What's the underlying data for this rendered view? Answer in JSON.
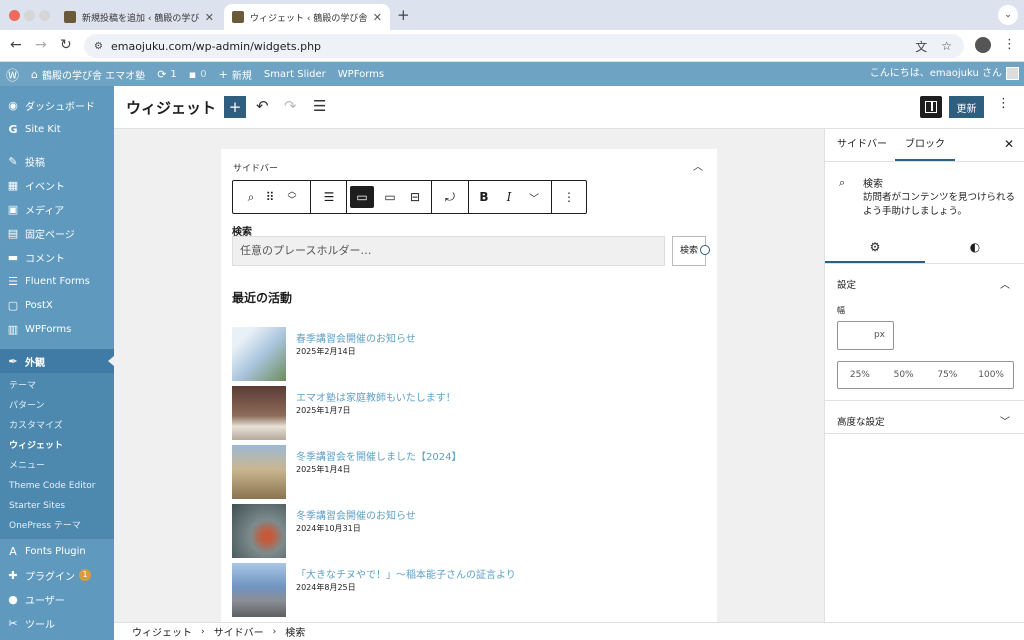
{
  "browser": {
    "tabs": [
      {
        "title": "新規投稿を追加 ‹ 鶴殿の学び舎 エマオ塾 — WordPress",
        "active": false
      },
      {
        "title": "ウィジェット ‹ 鶴殿の学び舎 エマオ塾 — WordPress",
        "active": true
      }
    ],
    "url": "emaojuku.com/wp-admin/widgets.php",
    "icons": [
      "back-icon",
      "forward-icon",
      "reload-icon",
      "site-settings-icon",
      "translate-icon",
      "bookmark-star-icon",
      "profile-avatar",
      "more-vert-icon"
    ]
  },
  "adminbar": {
    "site_name": "鶴殿の学び舎 エマオ塾",
    "updates": "1",
    "comments": "0",
    "new": "新規",
    "smart_slider": "Smart Slider",
    "wpforms": "WPForms",
    "howdy": "こんにちは、emaojuku さん"
  },
  "sidebar": {
    "items_top": [
      {
        "icon": "dashboard-icon",
        "label": "ダッシュボード"
      },
      {
        "icon": "site-kit-icon",
        "label": "Site Kit"
      },
      {
        "icon": "pin-icon",
        "label": "投稿"
      },
      {
        "icon": "calendar-icon",
        "label": "イベント"
      },
      {
        "icon": "media-icon",
        "label": "メディア"
      },
      {
        "icon": "page-icon",
        "label": "固定ページ"
      },
      {
        "icon": "comment-icon",
        "label": "コメント"
      },
      {
        "icon": "forms-icon",
        "label": "Fluent Forms"
      },
      {
        "icon": "postx-icon",
        "label": "PostX"
      },
      {
        "icon": "wpforms-icon",
        "label": "WPForms"
      }
    ],
    "current": {
      "icon": "appearance-icon",
      "label": "外観"
    },
    "submenu": [
      "テーマ",
      "パターン",
      "カスタマイズ",
      "ウィジェット",
      "メニュー",
      "Theme Code Editor",
      "Starter Sites",
      "OnePress テーマ"
    ],
    "active_submenu": "ウィジェット",
    "items_bottom": [
      {
        "icon": "fonts-icon",
        "label": "Fonts Plugin"
      },
      {
        "icon": "plugin-icon",
        "label": "プラグイン",
        "badge": "1"
      },
      {
        "icon": "user-icon",
        "label": "ユーザー"
      },
      {
        "icon": "tools-icon",
        "label": "ツール"
      }
    ]
  },
  "editor": {
    "title": "ウィジェット",
    "update_label": "更新"
  },
  "widget_area": {
    "title": "サイドバー",
    "search_label": "検索",
    "search_placeholder": "任意のプレースホルダー…",
    "search_button": "検索",
    "recent_title": "最近の活動",
    "posts": [
      {
        "title": "春季講習会開催のお知らせ",
        "date": "2025年2月14日",
        "thumb": "#bcd3e6"
      },
      {
        "title": "エマオ塾は家庭教師もいたします！",
        "date": "2025年1月7日",
        "thumb": "#7a5a4a"
      },
      {
        "title": "冬季講習会を開催しました【2024】",
        "date": "2025年1月4日",
        "thumb": "#9a8a6a"
      },
      {
        "title": "冬季講習会開催のお知らせ",
        "date": "2024年10月31日",
        "thumb": "#6a7a82"
      },
      {
        "title": "「大きなチヌやで！」〜稲本能子さんの証言より",
        "date": "2024年8月25日",
        "thumb": "#8aa6c4"
      }
    ]
  },
  "panel": {
    "tab_sidebar": "サイドバー",
    "tab_block": "ブロック",
    "block_name": "検索",
    "block_desc": "訪問者がコンテンツを見つけられるよう手助けしましょう。",
    "section_settings": "設定",
    "width_label": "幅",
    "width_unit": "px",
    "percent_options": [
      "25%",
      "50%",
      "75%",
      "100%"
    ],
    "advanced": "高度な設定"
  },
  "breadcrumb": [
    "ウィジェット",
    "サイドバー",
    "検索"
  ],
  "colors": {
    "admin_bar": "#6ea3c3",
    "sidebar": "#5f99bd",
    "accent": "#2f5f7e",
    "link": "#5fa1c5"
  }
}
